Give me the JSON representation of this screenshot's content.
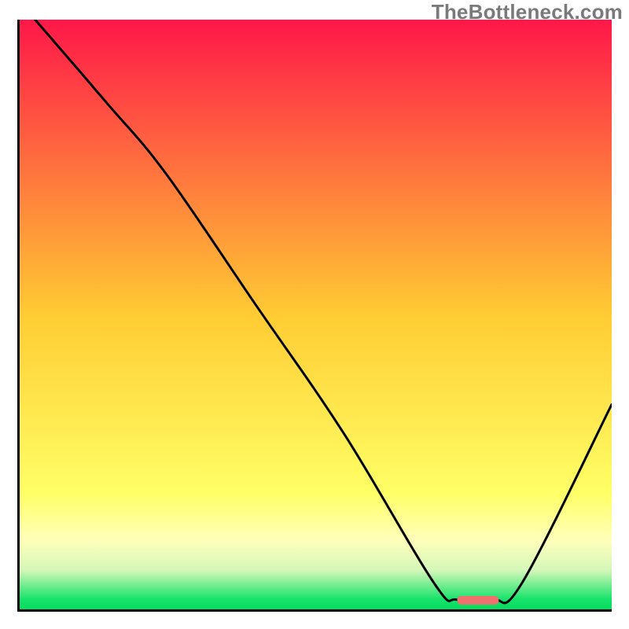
{
  "watermark": "TheBottleneck.com",
  "chart_data": {
    "type": "line",
    "title": "",
    "xlabel": "",
    "ylabel": "",
    "xlim": [
      0,
      100
    ],
    "ylim": [
      0,
      100
    ],
    "grid": false,
    "legend": false,
    "series": [
      {
        "name": "bottleneck-curve",
        "color": "#000000",
        "x": [
          3,
          15,
          25,
          40,
          55,
          70,
          74,
          80,
          85,
          100
        ],
        "y": [
          100,
          86,
          74,
          52,
          30,
          5,
          2,
          2,
          5,
          35
        ]
      }
    ],
    "marker": {
      "name": "optimal-range",
      "color": "#f06f6f",
      "x_start": 74,
      "x_end": 81,
      "y": 2
    },
    "background_gradient": {
      "stops": [
        {
          "pos": 0.0,
          "color": "#ff1749"
        },
        {
          "pos": 0.5,
          "color": "#ffcc33"
        },
        {
          "pos": 0.8,
          "color": "#ffff66"
        },
        {
          "pos": 0.88,
          "color": "#ffffbb"
        },
        {
          "pos": 0.93,
          "color": "#d4f7b8"
        },
        {
          "pos": 0.98,
          "color": "#14e36a"
        },
        {
          "pos": 1.0,
          "color": "#04d85a"
        }
      ]
    }
  }
}
